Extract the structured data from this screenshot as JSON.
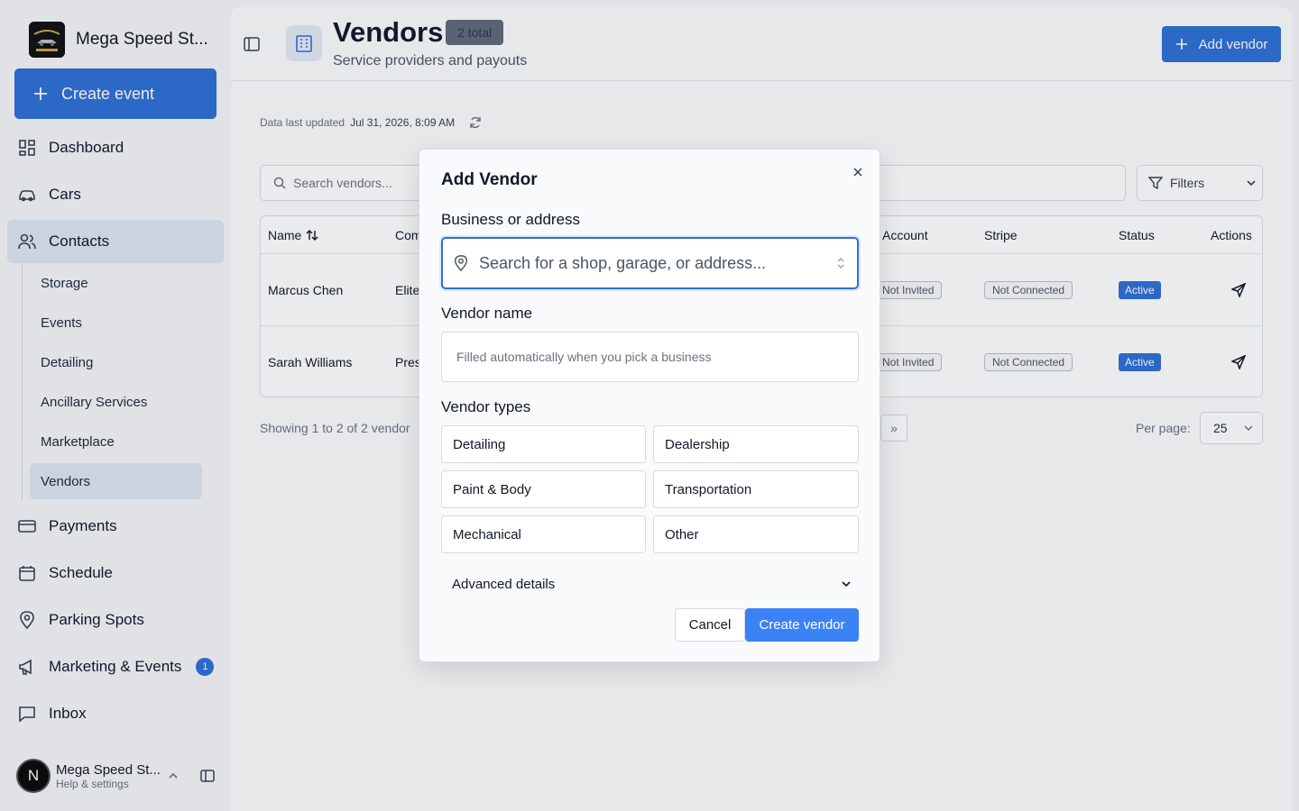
{
  "sidebar": {
    "brand": {
      "name": "Mega Speed St...",
      "logo_icon": "mega-speed-storage-logo"
    },
    "create_button": "Create event",
    "nav": [
      {
        "label": "Dashboard",
        "icon": "dashboard-icon"
      },
      {
        "label": "Cars",
        "icon": "car-icon"
      },
      {
        "label": "Contacts",
        "icon": "users-icon",
        "active": true
      },
      {
        "label": "Payments",
        "icon": "credit-card-icon"
      },
      {
        "label": "Schedule",
        "icon": "calendar-icon"
      },
      {
        "label": "Parking Spots",
        "icon": "map-pin-icon"
      },
      {
        "label": "Marketing & Events",
        "icon": "megaphone-icon",
        "badge": "1"
      },
      {
        "label": "Inbox",
        "icon": "message-icon"
      }
    ],
    "contacts_sub": [
      {
        "label": "Storage"
      },
      {
        "label": "Events"
      },
      {
        "label": "Detailing"
      },
      {
        "label": "Ancillary Services"
      },
      {
        "label": "Marketplace"
      },
      {
        "label": "Vendors",
        "active": true
      }
    ],
    "user": {
      "initial": "N",
      "name": "Mega Speed St...",
      "sub": "Help & settings"
    }
  },
  "header": {
    "title": "Vendors",
    "badge": "2 total",
    "subtitle": "Service providers and payouts",
    "add_button": "Add vendor"
  },
  "updated": {
    "prefix": "Data last updated",
    "value": "Jul 31, 2026, 8:09 AM"
  },
  "search": {
    "placeholder": "Search vendors..."
  },
  "filters": {
    "label": "Filters"
  },
  "table": {
    "columns": [
      "Name",
      "Com",
      "Account",
      "Stripe",
      "Status",
      "Actions"
    ],
    "rows": [
      {
        "name": "Marcus Chen",
        "company": "Elite",
        "account": "Not Invited",
        "stripe": "Not Connected",
        "status": "Active"
      },
      {
        "name": "Sarah Williams",
        "company": "Pres",
        "account": "Not Invited",
        "stripe": "Not Connected",
        "status": "Active"
      }
    ]
  },
  "pagination": {
    "showing": "Showing 1 to 2 of 2 vendor",
    "last_glyph": "»",
    "per_page_label": "Per page:",
    "per_page_value": "25"
  },
  "dialog": {
    "title": "Add Vendor",
    "address_label": "Business or address",
    "address_placeholder": "Search for a shop, garage, or address...",
    "name_label": "Vendor name",
    "name_placeholder": "Filled automatically when you pick a business",
    "types_label": "Vendor types",
    "types": [
      "Detailing",
      "Dealership",
      "Paint & Body",
      "Transportation",
      "Mechanical",
      "Other"
    ],
    "advanced": "Advanced details",
    "cancel": "Cancel",
    "submit": "Create vendor"
  },
  "colors": {
    "accent": "#2f6fd6",
    "active_nav": "#dde5f1",
    "badge": "#5f6b7c"
  }
}
